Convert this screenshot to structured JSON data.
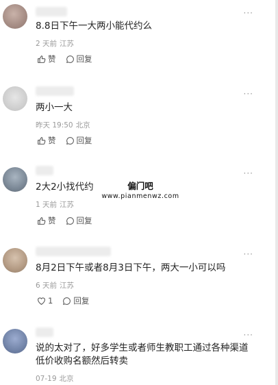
{
  "comments": [
    {
      "content": "8.8日下午一大两小能代约么",
      "time": "2 天前",
      "location": "江苏",
      "like_label": "赞",
      "reply_label": "回复"
    },
    {
      "content": "两小一大",
      "time": "昨天 19:50",
      "location": "北京",
      "like_label": "赞",
      "reply_label": "回复"
    },
    {
      "content": "2大2小找代约",
      "time": "1 天前",
      "location": "江苏",
      "like_label": "赞",
      "reply_label": "回复"
    },
    {
      "content": "8月2日下午或者8月3日下午，两大一小可以吗",
      "time": "6 天前",
      "location": "江苏",
      "like_label": "1",
      "reply_label": "回复"
    },
    {
      "content": "说的太对了，好多学生或者师生教职工通过各种渠道低价收购名额然后转卖",
      "time": "07-19",
      "location": "北京"
    }
  ],
  "more_glyph": "···",
  "watermark": {
    "title": "偏门吧",
    "url": "www.pianmenwz.com"
  },
  "colors": {
    "avatar_1": "#a58c84",
    "avatar_2": "#cfcfcf",
    "avatar_3": "#7b8896",
    "avatar_4": "#b39a83",
    "avatar_5": "#7284a8"
  }
}
